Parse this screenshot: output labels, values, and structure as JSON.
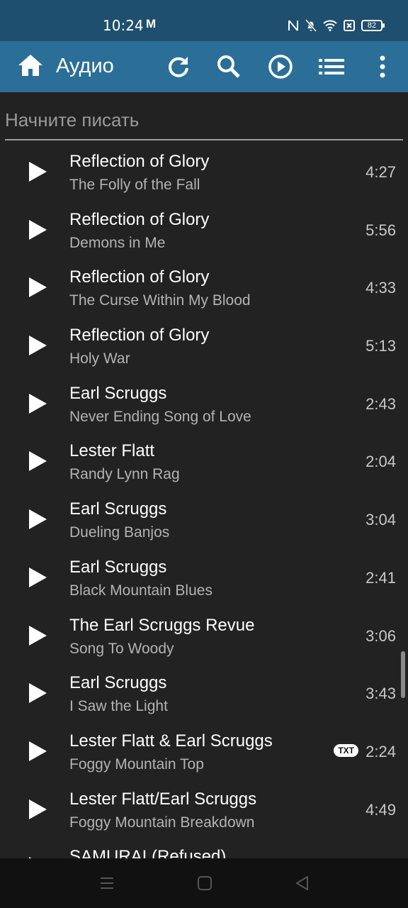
{
  "status": {
    "time": "10:24",
    "mail_icon": "M",
    "battery": "82"
  },
  "appbar": {
    "title": "Аудио",
    "icons": [
      "home-icon",
      "refresh-icon",
      "search-icon",
      "play-circle-icon",
      "list-icon",
      "more-vert-icon"
    ]
  },
  "search": {
    "placeholder": "Начните писать",
    "value": ""
  },
  "tracks": [
    {
      "artist": "Reflection of Glory",
      "title": "The Folly of the Fall",
      "duration": "4:27"
    },
    {
      "artist": "Reflection of Glory",
      "title": "Demons in Me",
      "duration": "5:56"
    },
    {
      "artist": "Reflection of Glory",
      "title": "The Curse Within My Blood",
      "duration": "4:33"
    },
    {
      "artist": "Reflection of Glory",
      "title": "Holy War",
      "duration": "5:13"
    },
    {
      "artist": "Earl Scruggs",
      "title": "Never Ending Song of Love",
      "duration": "2:43"
    },
    {
      "artist": "Lester Flatt",
      "title": "Randy Lynn Rag",
      "duration": "2:04"
    },
    {
      "artist": "Earl Scruggs",
      "title": "Dueling Banjos",
      "duration": "3:04"
    },
    {
      "artist": "Earl Scruggs",
      "title": "Black Mountain Blues",
      "duration": "2:41"
    },
    {
      "artist": "The Earl Scruggs Revue",
      "title": "Song To Woody",
      "duration": "3:06"
    },
    {
      "artist": "Earl Scruggs",
      "title": "I Saw the Light",
      "duration": "3:43"
    },
    {
      "artist": "Lester Flatt & Earl Scruggs",
      "title": "Foggy Mountain Top",
      "duration": "2:24",
      "badge": "TXT"
    },
    {
      "artist": "Lester Flatt/Earl Scruggs",
      "title": "Foggy Mountain Breakdown",
      "duration": "4:49"
    },
    {
      "artist": "SAMURAI (Refused)",
      "title": "",
      "duration": ""
    }
  ],
  "colors": {
    "statusbar": "#1f4f6e",
    "appbar": "#2b6f98",
    "background": "#222222",
    "secondary_text": "#b3b3b3"
  }
}
